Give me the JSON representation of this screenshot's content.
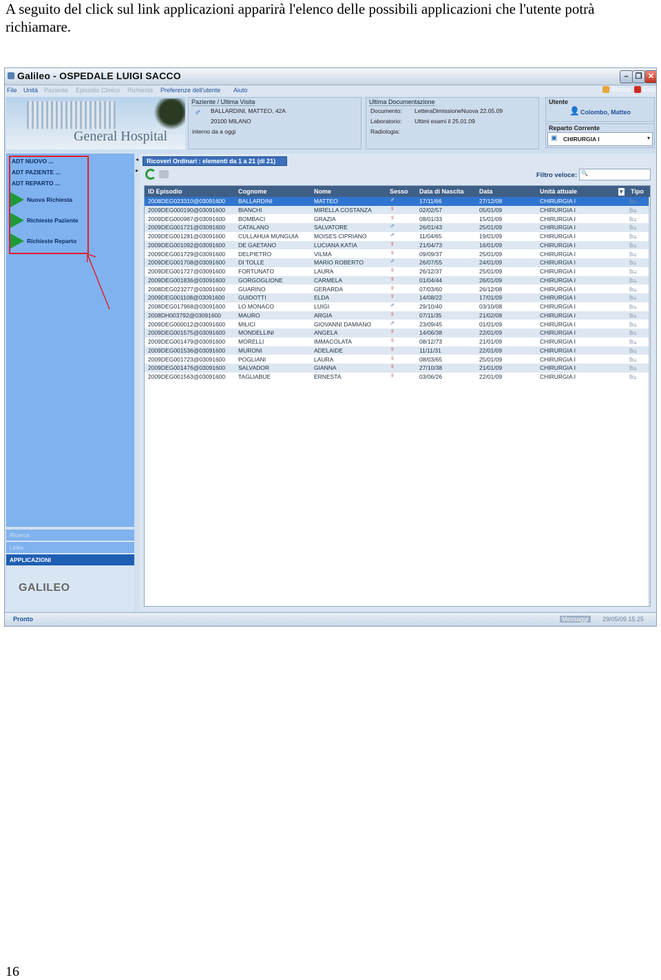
{
  "caption": "A seguito del click sul link applicazioni apparirà l'elenco delle possibili applicazioni che l'utente potrà richiamare.",
  "page_number": "16",
  "window": {
    "title": "Galileo - OSPEDALE LUIGI SACCO"
  },
  "menu": {
    "items": [
      {
        "label": "File",
        "enabled": true
      },
      {
        "label": "Unità",
        "enabled": true
      },
      {
        "label": "Paziente",
        "enabled": false
      },
      {
        "label": "Episodio Clinico",
        "enabled": false
      },
      {
        "label": "Richiesta",
        "enabled": false
      },
      {
        "label": "Preferenze dell'utente",
        "enabled": true
      },
      {
        "label": "Aiuto",
        "enabled": true
      }
    ],
    "blocca": "Blocca",
    "esci": "Esci"
  },
  "banner": {
    "text": "General Hospital"
  },
  "patient": {
    "title": "Paziente / Ultima Visita",
    "name": "BALLARDINI, MATTEO, 42A",
    "city": "20100 MILANO",
    "visit": "interno da a oggi"
  },
  "docs": {
    "title": "Ultima Documentazione",
    "documento_label": "Documento:",
    "documento_value": "LetteraDimissioneNuova 22.05.09",
    "laboratorio_label": "Laboratorio:",
    "laboratorio_value": "Ultimi esami il 25.01.09",
    "radiologia_label": "Radiologia:"
  },
  "user": {
    "title": "Utente",
    "name": "Colombo, Matteo",
    "reparto_title": "Reparto Corrente",
    "reparto_value": "CHIRURGIA I"
  },
  "sidebar": {
    "links": [
      "ADT NUOVO ...",
      "ADT PAZIENTE ...",
      "ADT REPARTO ..."
    ],
    "actions": [
      "Nuova Richiesta",
      "Richieste Paziente",
      "Richieste Reparto"
    ],
    "bottom": [
      "Ricerca",
      "Links",
      "APPLICAZIONI"
    ],
    "logo": "GALILEO"
  },
  "main": {
    "tab": "Ricoveri Ordinari : elementi da 1 a 21 (di 21)",
    "filter_label": "Filtro veloce:"
  },
  "table": {
    "headers": [
      "ID Episodio",
      "Cognome",
      "Nome",
      "Sesso",
      "Data di Nascita",
      "Data",
      "Unità attuale",
      "Tipo"
    ],
    "rows": [
      [
        "2008DEG023310@03091600",
        "BALLARDINI",
        "MATTEO",
        "M",
        "17/11/66",
        "27/12/08",
        "CHIRURGIA I"
      ],
      [
        "2009DEG000190@03091600",
        "BIANCHI",
        "MIRELLA COSTANZA",
        "F",
        "02/02/57",
        "05/01/09",
        "CHIRURGIA I"
      ],
      [
        "2009DEG000987@03091600",
        "BOMBACI",
        "GRAZIA",
        "F",
        "08/01/33",
        "15/01/09",
        "CHIRURGIA I"
      ],
      [
        "2009DEG001721@03091600",
        "CATALANO",
        "SALVATORE",
        "M",
        "26/01/43",
        "25/01/09",
        "CHIRURGIA I"
      ],
      [
        "2009DEG001281@03091600",
        "CULLAHUA MUNGUIA",
        "MOISES CIPRIANO",
        "M",
        "11/04/65",
        "19/01/09",
        "CHIRURGIA I"
      ],
      [
        "2009DEG001092@03091600",
        "DE GAETANO",
        "LUCIANA KATIA",
        "F",
        "21/04/73",
        "16/01/09",
        "CHIRURGIA I"
      ],
      [
        "2009DEG001729@03091600",
        "DELPIETRO",
        "VILMA",
        "F",
        "09/09/37",
        "25/01/09",
        "CHIRURGIA I"
      ],
      [
        "2009DEG001708@03091600",
        "DI TOLLE",
        "MARIO ROBERTO",
        "M",
        "26/07/55",
        "24/01/09",
        "CHIRURGIA I"
      ],
      [
        "2009DEG001727@03091600",
        "FORTUNATO",
        "LAURA",
        "F",
        "26/12/37",
        "25/01/09",
        "CHIRURGIA I"
      ],
      [
        "2009DEG001836@03091600",
        "GORGOGLIONE",
        "CARMELA",
        "F",
        "01/04/44",
        "26/01/09",
        "CHIRURGIA I"
      ],
      [
        "2008DEG023277@03091600",
        "GUARINO",
        "GERARDA",
        "F",
        "07/03/60",
        "26/12/08",
        "CHIRURGIA I"
      ],
      [
        "2009DEG001108@03091600",
        "GUIDOTTI",
        "ELDA",
        "F",
        "14/08/22",
        "17/01/09",
        "CHIRURGIA I"
      ],
      [
        "2008DEG017968@03091600",
        "LO MONACO",
        "LUIGI",
        "M",
        "29/10/40",
        "03/10/08",
        "CHIRURGIA I"
      ],
      [
        "2008DH003792@03091600",
        "MAURO",
        "ARGIA",
        "F",
        "07/11/35",
        "21/02/08",
        "CHIRURGIA I"
      ],
      [
        "2009DEG000012@03091600",
        "MILICI",
        "GIOVANNI DAMIANO",
        "M",
        "23/09/45",
        "01/01/09",
        "CHIRURGIA I"
      ],
      [
        "2009DEG001575@03091600",
        "MONDELLINI",
        "ANGELA",
        "F",
        "14/06/38",
        "22/01/09",
        "CHIRURGIA I"
      ],
      [
        "2009DEG001479@03091600",
        "MORELLI",
        "IMMACOLATA",
        "F",
        "08/12/73",
        "21/01/09",
        "CHIRURGIA I"
      ],
      [
        "2009DEG001536@03091600",
        "MURONI",
        "ADELAIDE",
        "F",
        "11/11/31",
        "22/01/09",
        "CHIRURGIA I"
      ],
      [
        "2009DEG001723@03091600",
        "POGLIANI",
        "LAURA",
        "F",
        "08/03/65",
        "25/01/09",
        "CHIRURGIA I"
      ],
      [
        "2009DEG001476@03091600",
        "SALVADOR",
        "GIANNA",
        "F",
        "27/10/38",
        "21/01/09",
        "CHIRURGIA I"
      ],
      [
        "2009DEG001563@03091600",
        "TAGLIABUE",
        "ERNESTA",
        "F",
        "03/06/26",
        "22/01/09",
        "CHIRURGIA I"
      ]
    ]
  },
  "status": {
    "left": "Pronto",
    "messaggi": "Messaggi",
    "datetime": "29/05/09 15.25"
  },
  "colors": {
    "accent": "#1e5fb3",
    "sidebar": "#7fb2ee",
    "highlight": "#e0202c"
  }
}
